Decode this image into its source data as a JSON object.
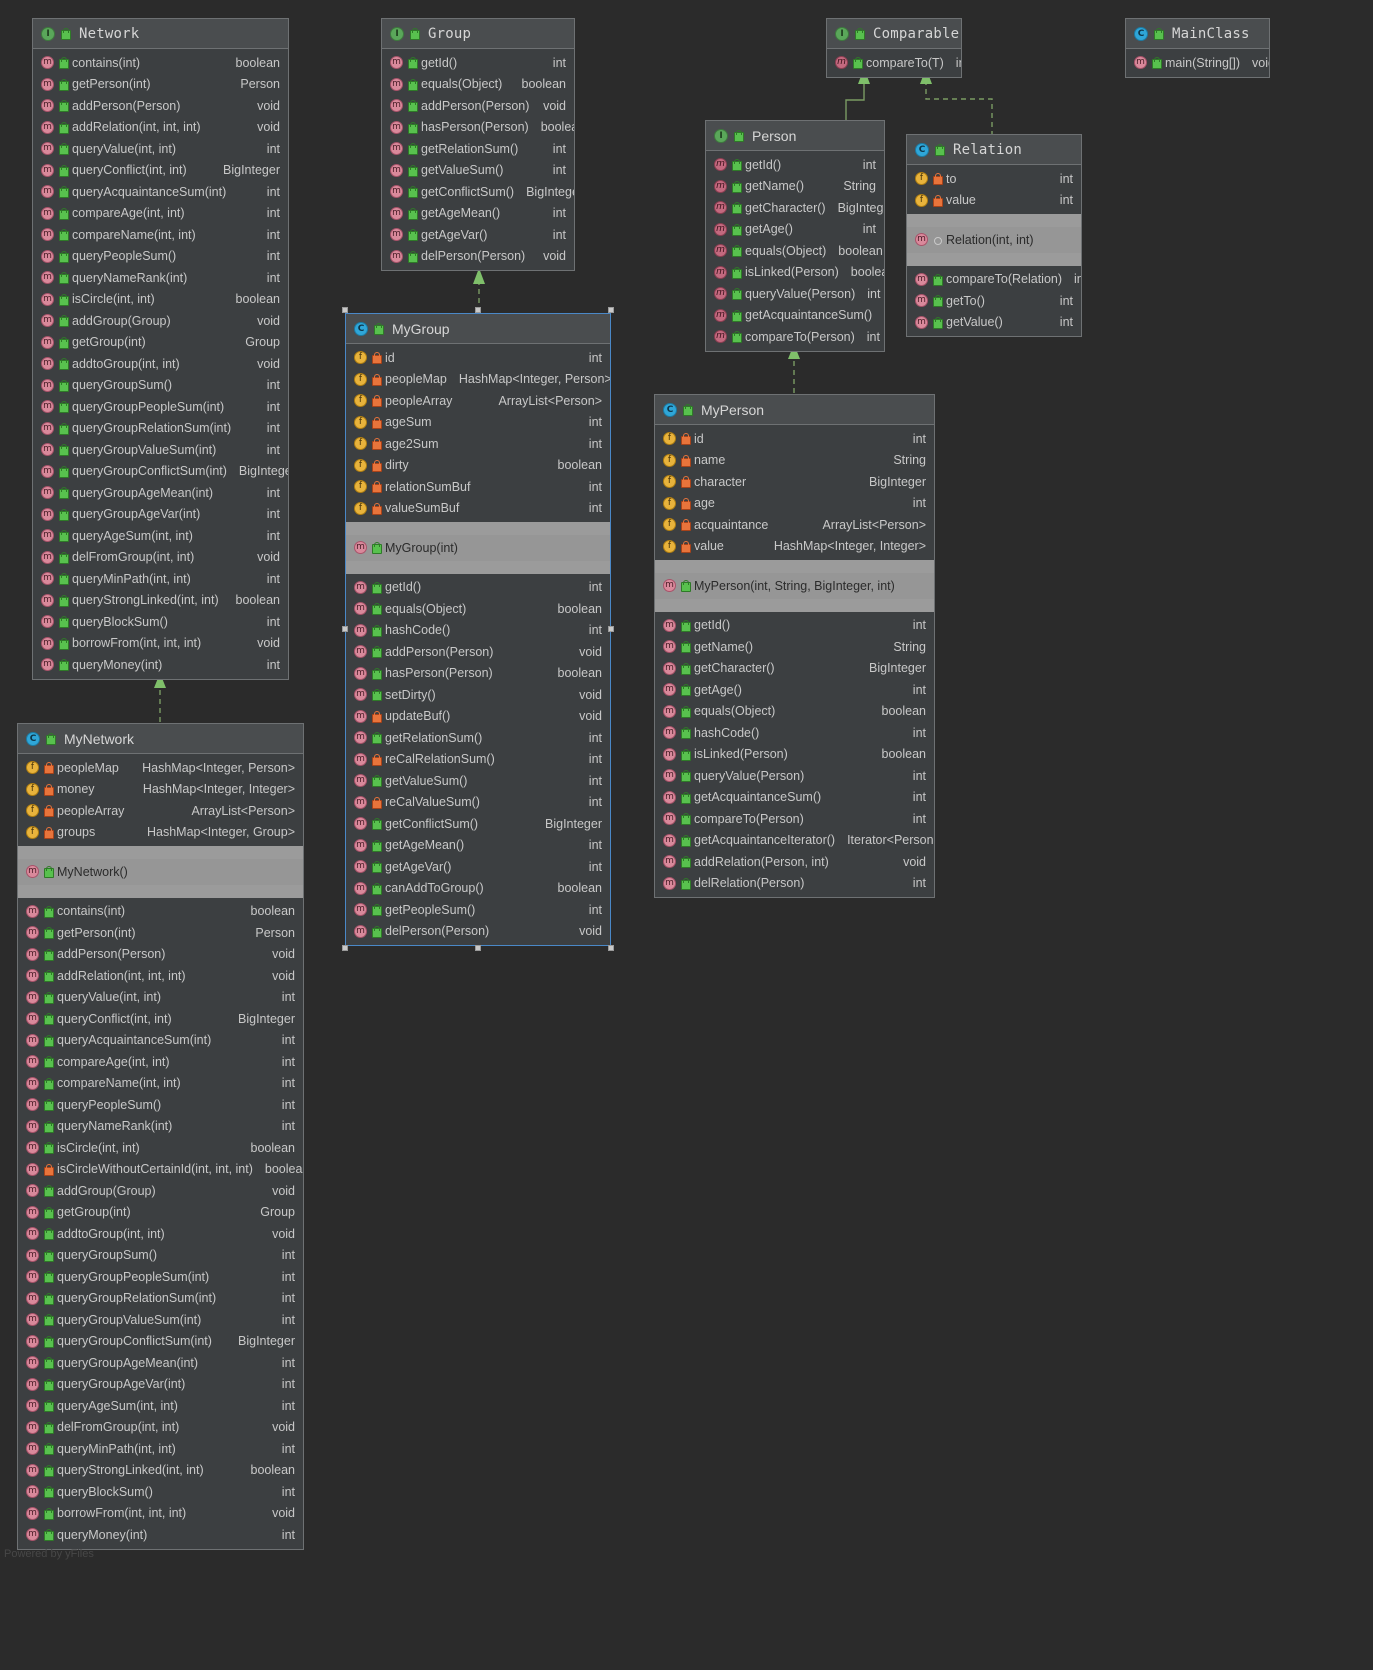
{
  "watermark": "Powered by yFiles",
  "icons": {
    "interface": "interface-icon",
    "class": "class-icon",
    "method": "method-icon",
    "field": "field-icon",
    "public": "public-visibility-icon",
    "private": "private-visibility-icon",
    "package": "package-visibility-icon"
  },
  "nodes": {
    "network": {
      "title": "Network",
      "kind": "interface",
      "methods": [
        {
          "name": "contains(int)",
          "type": "boolean",
          "vis": "public"
        },
        {
          "name": "getPerson(int)",
          "type": "Person",
          "vis": "public"
        },
        {
          "name": "addPerson(Person)",
          "type": "void",
          "vis": "public"
        },
        {
          "name": "addRelation(int, int, int)",
          "type": "void",
          "vis": "public"
        },
        {
          "name": "queryValue(int, int)",
          "type": "int",
          "vis": "public"
        },
        {
          "name": "queryConflict(int, int)",
          "type": "BigInteger",
          "vis": "public"
        },
        {
          "name": "queryAcquaintanceSum(int)",
          "type": "int",
          "vis": "public"
        },
        {
          "name": "compareAge(int, int)",
          "type": "int",
          "vis": "public"
        },
        {
          "name": "compareName(int, int)",
          "type": "int",
          "vis": "public"
        },
        {
          "name": "queryPeopleSum()",
          "type": "int",
          "vis": "public"
        },
        {
          "name": "queryNameRank(int)",
          "type": "int",
          "vis": "public"
        },
        {
          "name": "isCircle(int, int)",
          "type": "boolean",
          "vis": "public"
        },
        {
          "name": "addGroup(Group)",
          "type": "void",
          "vis": "public"
        },
        {
          "name": "getGroup(int)",
          "type": "Group",
          "vis": "public"
        },
        {
          "name": "addtoGroup(int, int)",
          "type": "void",
          "vis": "public"
        },
        {
          "name": "queryGroupSum()",
          "type": "int",
          "vis": "public"
        },
        {
          "name": "queryGroupPeopleSum(int)",
          "type": "int",
          "vis": "public"
        },
        {
          "name": "queryGroupRelationSum(int)",
          "type": "int",
          "vis": "public"
        },
        {
          "name": "queryGroupValueSum(int)",
          "type": "int",
          "vis": "public"
        },
        {
          "name": "queryGroupConflictSum(int)",
          "type": "BigInteger",
          "vis": "public"
        },
        {
          "name": "queryGroupAgeMean(int)",
          "type": "int",
          "vis": "public"
        },
        {
          "name": "queryGroupAgeVar(int)",
          "type": "int",
          "vis": "public"
        },
        {
          "name": "queryAgeSum(int, int)",
          "type": "int",
          "vis": "public"
        },
        {
          "name": "delFromGroup(int, int)",
          "type": "void",
          "vis": "public"
        },
        {
          "name": "queryMinPath(int, int)",
          "type": "int",
          "vis": "public"
        },
        {
          "name": "queryStrongLinked(int, int)",
          "type": "boolean",
          "vis": "public"
        },
        {
          "name": "queryBlockSum()",
          "type": "int",
          "vis": "public"
        },
        {
          "name": "borrowFrom(int, int, int)",
          "type": "void",
          "vis": "public"
        },
        {
          "name": "queryMoney(int)",
          "type": "int",
          "vis": "public"
        }
      ]
    },
    "group": {
      "title": "Group",
      "kind": "interface",
      "methods": [
        {
          "name": "getId()",
          "type": "int",
          "vis": "public"
        },
        {
          "name": "equals(Object)",
          "type": "boolean",
          "vis": "public"
        },
        {
          "name": "addPerson(Person)",
          "type": "void",
          "vis": "public"
        },
        {
          "name": "hasPerson(Person)",
          "type": "boolean",
          "vis": "public"
        },
        {
          "name": "getRelationSum()",
          "type": "int",
          "vis": "public"
        },
        {
          "name": "getValueSum()",
          "type": "int",
          "vis": "public"
        },
        {
          "name": "getConflictSum()",
          "type": "BigInteger",
          "vis": "public"
        },
        {
          "name": "getAgeMean()",
          "type": "int",
          "vis": "public"
        },
        {
          "name": "getAgeVar()",
          "type": "int",
          "vis": "public"
        },
        {
          "name": "delPerson(Person)",
          "type": "void",
          "vis": "public"
        }
      ]
    },
    "comparable": {
      "title": "Comparable",
      "kind": "interface",
      "methods": [
        {
          "name": "compareTo(T)",
          "type": "int",
          "vis": "public"
        }
      ]
    },
    "mainclass": {
      "title": "MainClass",
      "kind": "class",
      "methods": [
        {
          "name": "main(String[])",
          "type": "void",
          "vis": "public"
        }
      ]
    },
    "person": {
      "title": "Person",
      "kind": "interface",
      "methods": [
        {
          "name": "getId()",
          "type": "int",
          "vis": "public"
        },
        {
          "name": "getName()",
          "type": "String",
          "vis": "public"
        },
        {
          "name": "getCharacter()",
          "type": "BigInteger",
          "vis": "public"
        },
        {
          "name": "getAge()",
          "type": "int",
          "vis": "public"
        },
        {
          "name": "equals(Object)",
          "type": "boolean",
          "vis": "public"
        },
        {
          "name": "isLinked(Person)",
          "type": "boolean",
          "vis": "public"
        },
        {
          "name": "queryValue(Person)",
          "type": "int",
          "vis": "public"
        },
        {
          "name": "getAcquaintanceSum()",
          "type": "int",
          "vis": "public"
        },
        {
          "name": "compareTo(Person)",
          "type": "int",
          "vis": "public"
        }
      ]
    },
    "relation": {
      "title": "Relation",
      "kind": "class",
      "fields": [
        {
          "name": "to",
          "type": "int",
          "vis": "private"
        },
        {
          "name": "value",
          "type": "int",
          "vis": "private"
        }
      ],
      "constructors": [
        {
          "name": "Relation(int, int)",
          "type": "",
          "vis": "package"
        }
      ],
      "methods": [
        {
          "name": "compareTo(Relation)",
          "type": "int",
          "vis": "public"
        },
        {
          "name": "getTo()",
          "type": "int",
          "vis": "public"
        },
        {
          "name": "getValue()",
          "type": "int",
          "vis": "public"
        }
      ]
    },
    "mygroup": {
      "title": "MyGroup",
      "kind": "class",
      "selected": true,
      "fields": [
        {
          "name": "id",
          "type": "int",
          "vis": "private"
        },
        {
          "name": "peopleMap",
          "type": "HashMap<Integer, Person>",
          "vis": "private"
        },
        {
          "name": "peopleArray",
          "type": "ArrayList<Person>",
          "vis": "private"
        },
        {
          "name": "ageSum",
          "type": "int",
          "vis": "private"
        },
        {
          "name": "age2Sum",
          "type": "int",
          "vis": "private"
        },
        {
          "name": "dirty",
          "type": "boolean",
          "vis": "private"
        },
        {
          "name": "relationSumBuf",
          "type": "int",
          "vis": "private"
        },
        {
          "name": "valueSumBuf",
          "type": "int",
          "vis": "private"
        }
      ],
      "constructors": [
        {
          "name": "MyGroup(int)",
          "type": "",
          "vis": "public"
        }
      ],
      "methods": [
        {
          "name": "getId()",
          "type": "int",
          "vis": "public"
        },
        {
          "name": "equals(Object)",
          "type": "boolean",
          "vis": "public"
        },
        {
          "name": "hashCode()",
          "type": "int",
          "vis": "public"
        },
        {
          "name": "addPerson(Person)",
          "type": "void",
          "vis": "public"
        },
        {
          "name": "hasPerson(Person)",
          "type": "boolean",
          "vis": "public"
        },
        {
          "name": "setDirty()",
          "type": "void",
          "vis": "public"
        },
        {
          "name": "updateBuf()",
          "type": "void",
          "vis": "private"
        },
        {
          "name": "getRelationSum()",
          "type": "int",
          "vis": "public"
        },
        {
          "name": "reCalRelationSum()",
          "type": "int",
          "vis": "private"
        },
        {
          "name": "getValueSum()",
          "type": "int",
          "vis": "public"
        },
        {
          "name": "reCalValueSum()",
          "type": "int",
          "vis": "private"
        },
        {
          "name": "getConflictSum()",
          "type": "BigInteger",
          "vis": "public"
        },
        {
          "name": "getAgeMean()",
          "type": "int",
          "vis": "public"
        },
        {
          "name": "getAgeVar()",
          "type": "int",
          "vis": "public"
        },
        {
          "name": "canAddToGroup()",
          "type": "boolean",
          "vis": "public"
        },
        {
          "name": "getPeopleSum()",
          "type": "int",
          "vis": "public"
        },
        {
          "name": "delPerson(Person)",
          "type": "void",
          "vis": "public"
        }
      ]
    },
    "myperson": {
      "title": "MyPerson",
      "kind": "class",
      "fields": [
        {
          "name": "id",
          "type": "int",
          "vis": "private"
        },
        {
          "name": "name",
          "type": "String",
          "vis": "private"
        },
        {
          "name": "character",
          "type": "BigInteger",
          "vis": "private"
        },
        {
          "name": "age",
          "type": "int",
          "vis": "private"
        },
        {
          "name": "acquaintance",
          "type": "ArrayList<Person>",
          "vis": "private"
        },
        {
          "name": "value",
          "type": "HashMap<Integer, Integer>",
          "vis": "private"
        }
      ],
      "constructors": [
        {
          "name": "MyPerson(int, String, BigInteger, int)",
          "type": "",
          "vis": "public"
        }
      ],
      "methods": [
        {
          "name": "getId()",
          "type": "int",
          "vis": "public"
        },
        {
          "name": "getName()",
          "type": "String",
          "vis": "public"
        },
        {
          "name": "getCharacter()",
          "type": "BigInteger",
          "vis": "public"
        },
        {
          "name": "getAge()",
          "type": "int",
          "vis": "public"
        },
        {
          "name": "equals(Object)",
          "type": "boolean",
          "vis": "public"
        },
        {
          "name": "hashCode()",
          "type": "int",
          "vis": "public"
        },
        {
          "name": "isLinked(Person)",
          "type": "boolean",
          "vis": "public"
        },
        {
          "name": "queryValue(Person)",
          "type": "int",
          "vis": "public"
        },
        {
          "name": "getAcquaintanceSum()",
          "type": "int",
          "vis": "public"
        },
        {
          "name": "compareTo(Person)",
          "type": "int",
          "vis": "public"
        },
        {
          "name": "getAcquaintanceIterator()",
          "type": "Iterator<Person>",
          "vis": "public"
        },
        {
          "name": "addRelation(Person, int)",
          "type": "void",
          "vis": "public"
        },
        {
          "name": "delRelation(Person)",
          "type": "int",
          "vis": "public"
        }
      ]
    },
    "mynetwork": {
      "title": "MyNetwork",
      "kind": "class",
      "fields": [
        {
          "name": "peopleMap",
          "type": "HashMap<Integer, Person>",
          "vis": "private"
        },
        {
          "name": "money",
          "type": "HashMap<Integer, Integer>",
          "vis": "private"
        },
        {
          "name": "peopleArray",
          "type": "ArrayList<Person>",
          "vis": "private"
        },
        {
          "name": "groups",
          "type": "HashMap<Integer, Group>",
          "vis": "private"
        }
      ],
      "constructors": [
        {
          "name": "MyNetwork()",
          "type": "",
          "vis": "public"
        }
      ],
      "methods": [
        {
          "name": "contains(int)",
          "type": "boolean",
          "vis": "public"
        },
        {
          "name": "getPerson(int)",
          "type": "Person",
          "vis": "public"
        },
        {
          "name": "addPerson(Person)",
          "type": "void",
          "vis": "public"
        },
        {
          "name": "addRelation(int, int, int)",
          "type": "void",
          "vis": "public"
        },
        {
          "name": "queryValue(int, int)",
          "type": "int",
          "vis": "public"
        },
        {
          "name": "queryConflict(int, int)",
          "type": "BigInteger",
          "vis": "public"
        },
        {
          "name": "queryAcquaintanceSum(int)",
          "type": "int",
          "vis": "public"
        },
        {
          "name": "compareAge(int, int)",
          "type": "int",
          "vis": "public"
        },
        {
          "name": "compareName(int, int)",
          "type": "int",
          "vis": "public"
        },
        {
          "name": "queryPeopleSum()",
          "type": "int",
          "vis": "public"
        },
        {
          "name": "queryNameRank(int)",
          "type": "int",
          "vis": "public"
        },
        {
          "name": "isCircle(int, int)",
          "type": "boolean",
          "vis": "public"
        },
        {
          "name": "isCircleWithoutCertainId(int, int, int)",
          "type": "boolean",
          "vis": "private"
        },
        {
          "name": "addGroup(Group)",
          "type": "void",
          "vis": "public"
        },
        {
          "name": "getGroup(int)",
          "type": "Group",
          "vis": "public"
        },
        {
          "name": "addtoGroup(int, int)",
          "type": "void",
          "vis": "public"
        },
        {
          "name": "queryGroupSum()",
          "type": "int",
          "vis": "public"
        },
        {
          "name": "queryGroupPeopleSum(int)",
          "type": "int",
          "vis": "public"
        },
        {
          "name": "queryGroupRelationSum(int)",
          "type": "int",
          "vis": "public"
        },
        {
          "name": "queryGroupValueSum(int)",
          "type": "int",
          "vis": "public"
        },
        {
          "name": "queryGroupConflictSum(int)",
          "type": "BigInteger",
          "vis": "public"
        },
        {
          "name": "queryGroupAgeMean(int)",
          "type": "int",
          "vis": "public"
        },
        {
          "name": "queryGroupAgeVar(int)",
          "type": "int",
          "vis": "public"
        },
        {
          "name": "queryAgeSum(int, int)",
          "type": "int",
          "vis": "public"
        },
        {
          "name": "delFromGroup(int, int)",
          "type": "void",
          "vis": "public"
        },
        {
          "name": "queryMinPath(int, int)",
          "type": "int",
          "vis": "public"
        },
        {
          "name": "queryStrongLinked(int, int)",
          "type": "boolean",
          "vis": "public"
        },
        {
          "name": "queryBlockSum()",
          "type": "int",
          "vis": "public"
        },
        {
          "name": "borrowFrom(int, int, int)",
          "type": "void",
          "vis": "public"
        },
        {
          "name": "queryMoney(int)",
          "type": "int",
          "vis": "public"
        }
      ]
    }
  },
  "edges": [
    {
      "name": "mynetwork-implements-network",
      "style": "dashed"
    },
    {
      "name": "mygroup-implements-group",
      "style": "dashed"
    },
    {
      "name": "myperson-implements-person",
      "style": "dashed"
    },
    {
      "name": "person-extends-comparable",
      "style": "solid"
    },
    {
      "name": "relation-implements-comparable",
      "style": "dashed"
    }
  ],
  "colors": {
    "background": "#2b2b2b",
    "node_body": "#3c3f41",
    "node_header": "#4a4d4f",
    "node_border": "#6e7173",
    "divider": "#9b9b9b",
    "selection": "#4a88c7",
    "edge": "#6a9a55",
    "text": "#c8c8c8"
  }
}
